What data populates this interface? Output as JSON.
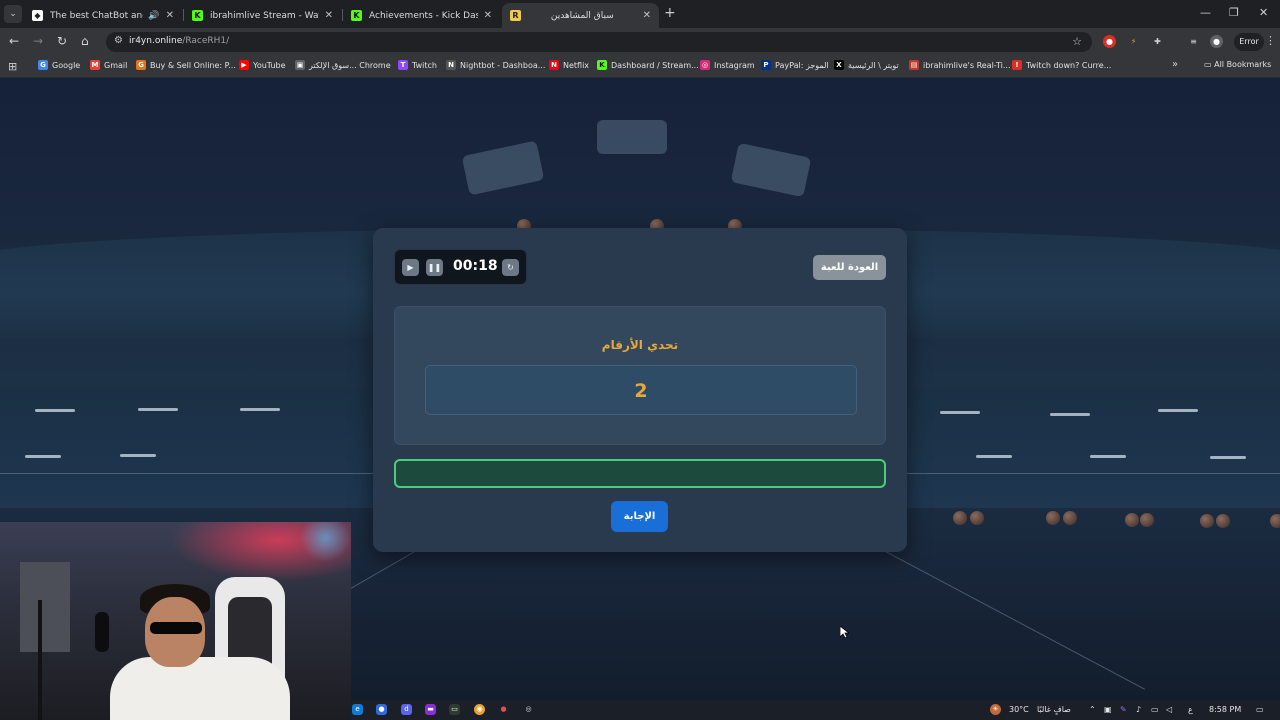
{
  "browser": {
    "tabs": [
      {
        "title": "The best ChatBot and Widg",
        "audio": "🔊",
        "active": false
      },
      {
        "title": "ibrahimlive Stream - Watch Live",
        "active": false
      },
      {
        "title": "Achievements - Kick Dashboard",
        "active": false
      },
      {
        "title": "سباق المشاهدين",
        "active": true
      }
    ],
    "new_tab": "+",
    "url_host": "ir4yn.online",
    "url_path": "/RaceRH1/",
    "profile_status": "Error",
    "bookmarks": [
      {
        "label": "Google",
        "icon": "google-icon",
        "color": "#4285f4"
      },
      {
        "label": "Gmail",
        "icon": "gmail-icon",
        "color": "#ea4335"
      },
      {
        "label": "Buy & Sell Online: P...",
        "icon": "store-icon",
        "color": "#e8711a"
      },
      {
        "label": "YouTube",
        "icon": "youtube-icon",
        "color": "#ff0000"
      },
      {
        "label": "سوق الإلكتر... Chrome",
        "icon": "chrome-store-icon",
        "color": "#5f6368"
      },
      {
        "label": "Twitch",
        "icon": "twitch-icon",
        "color": "#9146ff"
      },
      {
        "label": "Nightbot - Dashboa...",
        "icon": "nightbot-icon",
        "color": "#555555"
      },
      {
        "label": "Netflix",
        "icon": "netflix-icon",
        "color": "#e50914"
      },
      {
        "label": "Dashboard / Stream...",
        "icon": "kick-icon",
        "color": "#53fc18"
      },
      {
        "label": "Instagram",
        "icon": "instagram-icon",
        "color": "#d62976"
      },
      {
        "label": "PayPal: الموجز",
        "icon": "paypal-icon",
        "color": "#003087"
      },
      {
        "label": "تويتر \\ الرئيسية",
        "icon": "x-icon",
        "color": "#000000"
      },
      {
        "label": "ibrahimlive's Real-Ti...",
        "icon": "stats-icon",
        "color": "#c0392b"
      },
      {
        "label": "Twitch down? Curre...",
        "icon": "alert-icon",
        "color": "#d93025"
      }
    ],
    "all_bookmarks": "All Bookmarks"
  },
  "game": {
    "timer": "00:18",
    "back_label": "العودة للعبة",
    "challenge_title": "تحدي الأرقام",
    "challenge_number": "2",
    "answer_value": "",
    "answer_label": "الإجابة"
  },
  "taskbar": {
    "temperature": "30°C",
    "weather": "صافٍ غالبًا",
    "lang": "ع",
    "time": "8:58 PM"
  },
  "colors": {
    "accent_orange": "#e7a83c",
    "answer_blue": "#1a6ed8",
    "input_green": "#4ecb7d"
  }
}
